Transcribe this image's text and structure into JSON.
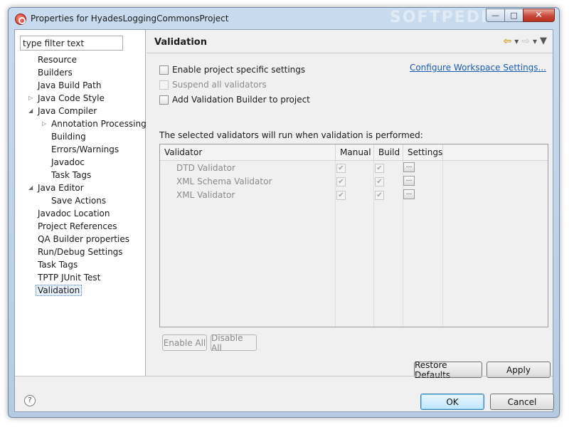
{
  "window": {
    "title": "Properties for HyadesLoggingCommonsProject",
    "watermark": "SOFTPEDIA"
  },
  "filter": {
    "value": "type filter text"
  },
  "tree": [
    {
      "label": "Resource",
      "level": 1,
      "expander": ""
    },
    {
      "label": "Builders",
      "level": 1,
      "expander": ""
    },
    {
      "label": "Java Build Path",
      "level": 1,
      "expander": ""
    },
    {
      "label": "Java Code Style",
      "level": 1,
      "expander": "collapsed"
    },
    {
      "label": "Java Compiler",
      "level": 1,
      "expander": "expanded"
    },
    {
      "label": "Annotation Processing",
      "level": 2,
      "expander": "collapsed"
    },
    {
      "label": "Building",
      "level": 2,
      "expander": ""
    },
    {
      "label": "Errors/Warnings",
      "level": 2,
      "expander": ""
    },
    {
      "label": "Javadoc",
      "level": 2,
      "expander": ""
    },
    {
      "label": "Task Tags",
      "level": 2,
      "expander": ""
    },
    {
      "label": "Java Editor",
      "level": 1,
      "expander": "expanded"
    },
    {
      "label": "Save Actions",
      "level": 2,
      "expander": ""
    },
    {
      "label": "Javadoc Location",
      "level": 1,
      "expander": ""
    },
    {
      "label": "Project References",
      "level": 1,
      "expander": ""
    },
    {
      "label": "QA Builder properties",
      "level": 1,
      "expander": ""
    },
    {
      "label": "Run/Debug Settings",
      "level": 1,
      "expander": ""
    },
    {
      "label": "Task Tags",
      "level": 1,
      "expander": ""
    },
    {
      "label": "TPTP JUnit Test",
      "level": 1,
      "expander": ""
    },
    {
      "label": "Validation",
      "level": 1,
      "expander": "",
      "selected": true
    }
  ],
  "page": {
    "title": "Validation",
    "enable_specific": "Enable project specific settings",
    "suspend_all": "Suspend all validators",
    "add_builder": "Add Validation Builder to project",
    "configure_link": "Configure Workspace Settings...",
    "info": "The selected validators will run when validation is performed:"
  },
  "table": {
    "columns": [
      "Validator",
      "Manual",
      "Build",
      "Settings"
    ],
    "rows": [
      {
        "name": "DTD Validator",
        "manual": true,
        "build": true,
        "settings": "..."
      },
      {
        "name": "XML Schema Validator",
        "manual": true,
        "build": true,
        "settings": "..."
      },
      {
        "name": "XML Validator",
        "manual": true,
        "build": true,
        "settings": "..."
      }
    ]
  },
  "buttons": {
    "enable_all": "Enable All",
    "disable_all": "Disable All",
    "restore_defaults": "Restore Defaults",
    "apply": "Apply",
    "ok": "OK",
    "cancel": "Cancel",
    "help": "?"
  }
}
